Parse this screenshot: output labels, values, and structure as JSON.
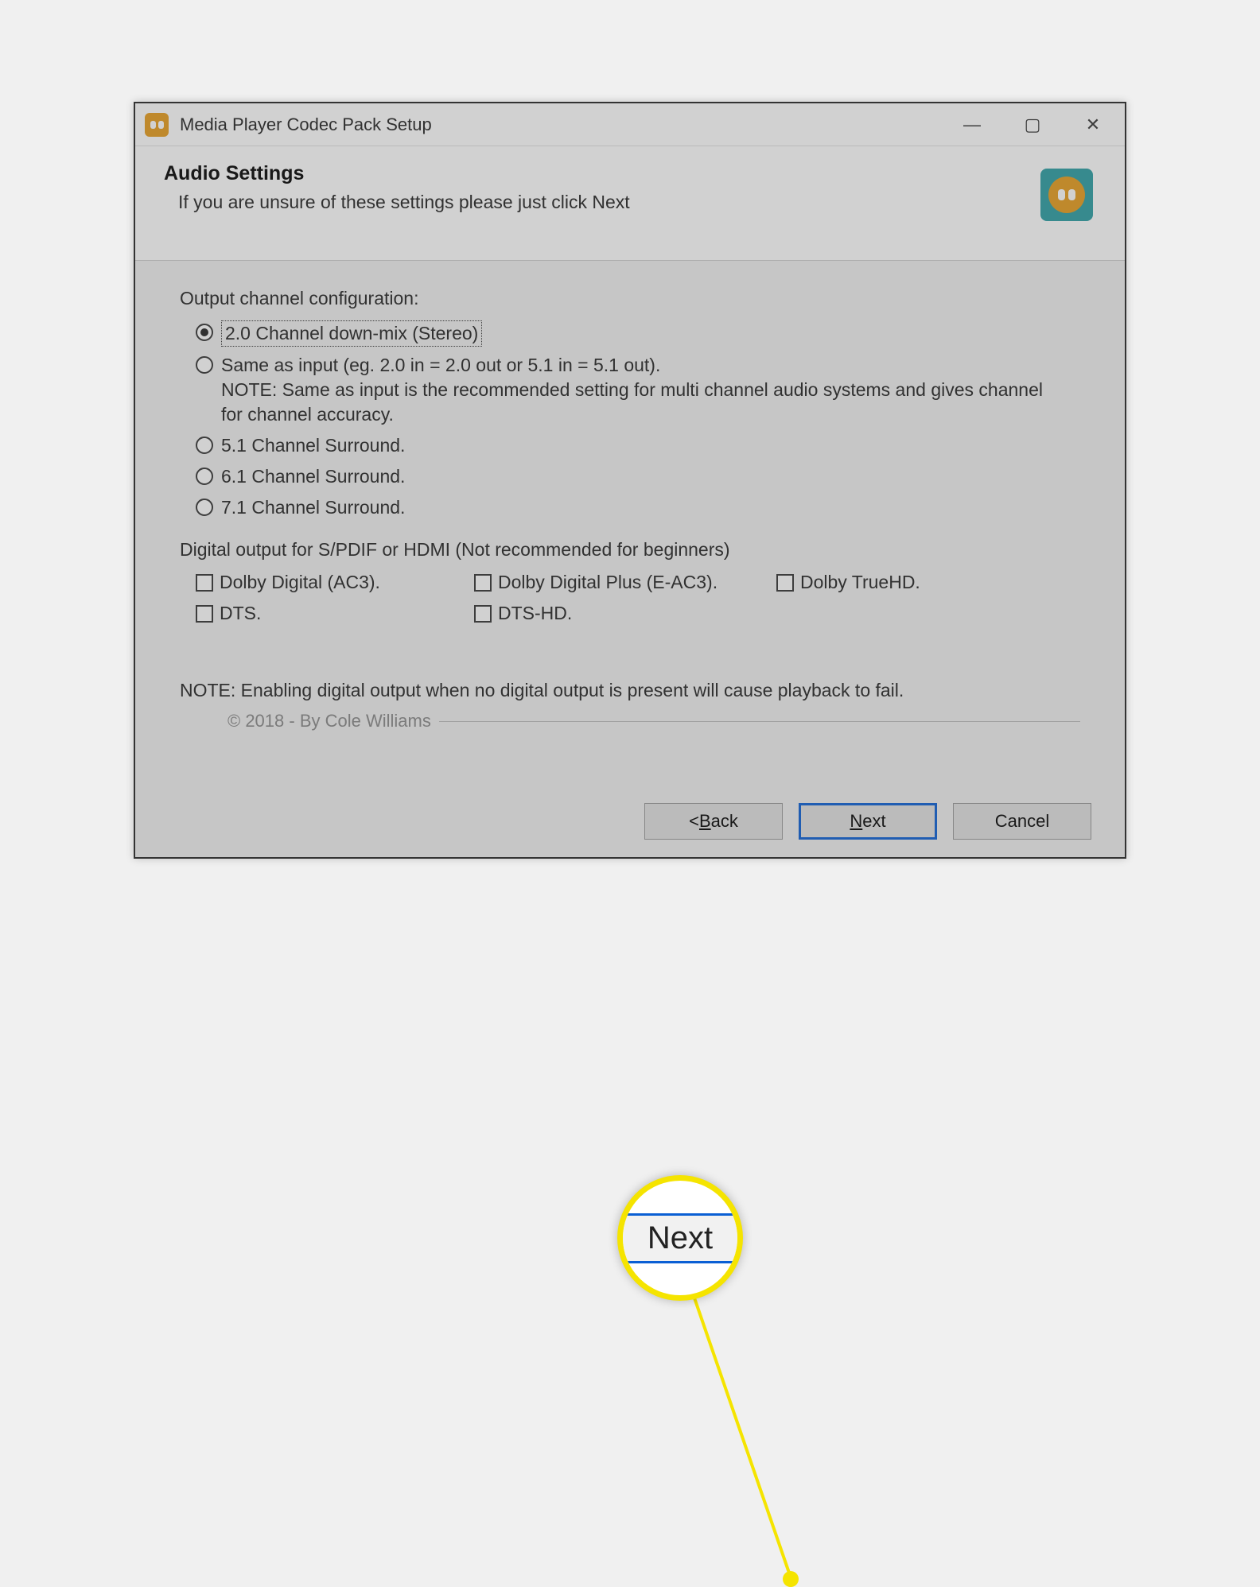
{
  "titlebar": {
    "title": "Media Player Codec Pack Setup"
  },
  "header": {
    "title": "Audio Settings",
    "subtitle": "If you are unsure of these settings please just click Next"
  },
  "output": {
    "label": "Output channel configuration:",
    "options": {
      "opt1": "2.0 Channel down-mix (Stereo)",
      "opt2_line1": "Same as input (eg. 2.0 in = 2.0 out or 5.1 in = 5.1 out).",
      "opt2_line2": "NOTE: Same as input is the recommended setting for multi channel audio systems and gives channel for channel accuracy.",
      "opt3": "5.1 Channel Surround.",
      "opt4": "6.1 Channel Surround.",
      "opt5": "7.1 Channel Surround."
    }
  },
  "digital": {
    "label": "Digital output for S/PDIF or HDMI (Not recommended for beginners)",
    "checks": {
      "c1": "Dolby Digital (AC3).",
      "c2": "Dolby Digital Plus (E-AC3).",
      "c3": "Dolby TrueHD.",
      "c4": "DTS.",
      "c5": "DTS-HD."
    }
  },
  "note": "NOTE: Enabling digital output when no digital output is present will cause playback to fail.",
  "copyright": "© 2018 - By Cole Williams",
  "buttons": {
    "back_prefix": "< ",
    "back_u": "B",
    "back_rest": "ack",
    "next_u": "N",
    "next_rest": "ext",
    "cancel": "Cancel"
  },
  "callout": {
    "text": "Next"
  }
}
